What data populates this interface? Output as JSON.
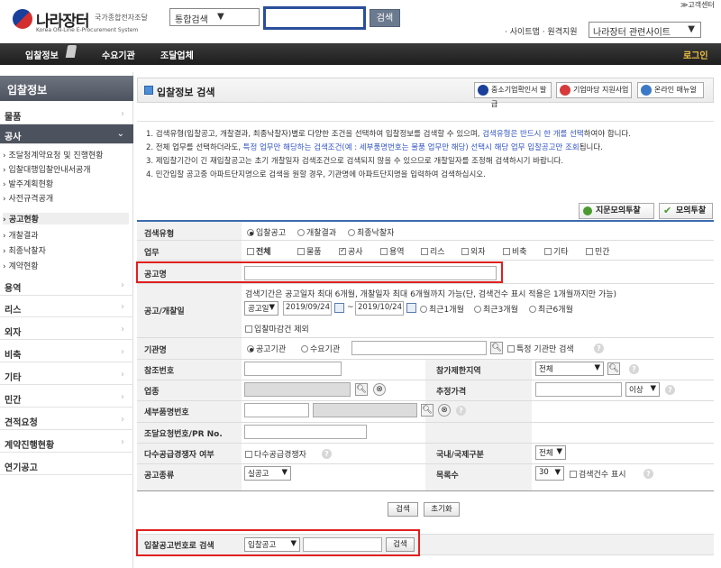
{
  "header": {
    "logo_text": "나라장터",
    "logo_sub": "국가종합전자조달",
    "logo_eng": "Korea ON-Line E-Procurement System",
    "scope_value": "통합검색",
    "search_button": "검색",
    "cs_link": "≫고객센터",
    "top_links": "· 사이트맵 · 원격지원",
    "related_select": "나라장터 관련사이트"
  },
  "nav": {
    "items": [
      "입찰정보",
      "수요기관",
      "조달업체"
    ],
    "login": "로그인"
  },
  "sidebar": {
    "title": "입찰정보",
    "rows": [
      "물품",
      "공사",
      "용역",
      "리스",
      "외자",
      "비축",
      "기타",
      "민간",
      "견적요청",
      "계약진행현황",
      "연기공고"
    ],
    "sub_items": [
      "› 조달청계약요청 및 진행현황",
      "› 입찰대행입찰안내서공개",
      "› 발주계획현황",
      "› 사전규격공개",
      "› 공고현황",
      "› 개찰결과",
      "› 최종낙찰자",
      "› 계약현황"
    ]
  },
  "main": {
    "title": "입찰정보 검색",
    "top_buttons": [
      "중소기업확인서 발급",
      "기업마당 지원사업",
      "온라인 매뉴얼"
    ],
    "notices": {
      "n1a": "1. 검색유형(입찰공고, 개찰결과, 최종낙찰자)별로 다양한 조건을 선택하여 입찰정보를 검색할 수 있으며, ",
      "n1b": "검색유형은 반드시 한 개를 선택",
      "n1c": "하여야 합니다.",
      "n2a": "2. 전체 업무를 선택하더라도, ",
      "n2b": "특정 업무만 해당하는 검색조건(예 : 세부품명번호는 물품 업무만 해당) 선택시 해당 업무 입찰공고만 조회",
      "n2c": "됩니다.",
      "n3": "3. 제입찰기간이 긴 재입찰공고는 초기 개찰일자 검색조건으로 검색되지 않을 수 있으므로 개찰일자를 조정해 검색하시기 바랍니다.",
      "n4": "4. 민간입찰 공고중 아파트단지명으로 검색을 원할 경우, 기관명에 아파트단지명을 입력하여 검색하십시오."
    },
    "btn_collective": "지문모의투찰",
    "btn_mock": "모의투찰"
  },
  "form": {
    "labels": {
      "search_type": "검색유형",
      "business": "업무",
      "notice_name": "공고명",
      "notice_date": "공고/개찰일",
      "agency": "기관명",
      "ref_no": "참조번호",
      "industry": "업종",
      "item_no": "세부품명번호",
      "procure_no": "조달요청번호/PR No.",
      "multi_supplier": "다수공급경쟁자 여부",
      "notice_kind": "공고종류",
      "region": "참가제한지역",
      "est_price": "추정가격",
      "domestic": "국내/국제구분",
      "list_count": "목록수"
    },
    "search_type_opts": [
      "입찰공고",
      "개찰결과",
      "최종낙찰자"
    ],
    "business_opts": [
      "전체",
      "물품",
      "공사",
      "용역",
      "리스",
      "외자",
      "비축",
      "기타",
      "민간"
    ],
    "period_note": "검색기간은 공고일자 최대 6개월, 개찰일자 최대 6개월까지 가능(단, 검색건수 표시 적용은 1개월까지만 가능)",
    "date_type": "공고일",
    "date_from": "2019/09/24",
    "tilde": "~",
    "date_to": "2019/10/24",
    "range_opts": [
      "최근1개월",
      "최근3개월",
      "최근6개월"
    ],
    "exclude_closed": "입찰마감건 제외",
    "agency_opts": [
      "공고기관",
      "수요기관"
    ],
    "specific_agency": "특정 기관만 검색",
    "region_value": "전체",
    "price_cmp": "이상",
    "domestic_value": "전체",
    "multi_label": "다수공급경쟁자",
    "notice_kind_value": "실공고",
    "list_count_value": "30",
    "show_count": "검색건수 표시",
    "search_btn": "검색",
    "reset_btn": "초기화"
  },
  "bottom": {
    "label": "입찰공고번호로 검색",
    "select_value": "입찰공고",
    "button": "검색"
  }
}
